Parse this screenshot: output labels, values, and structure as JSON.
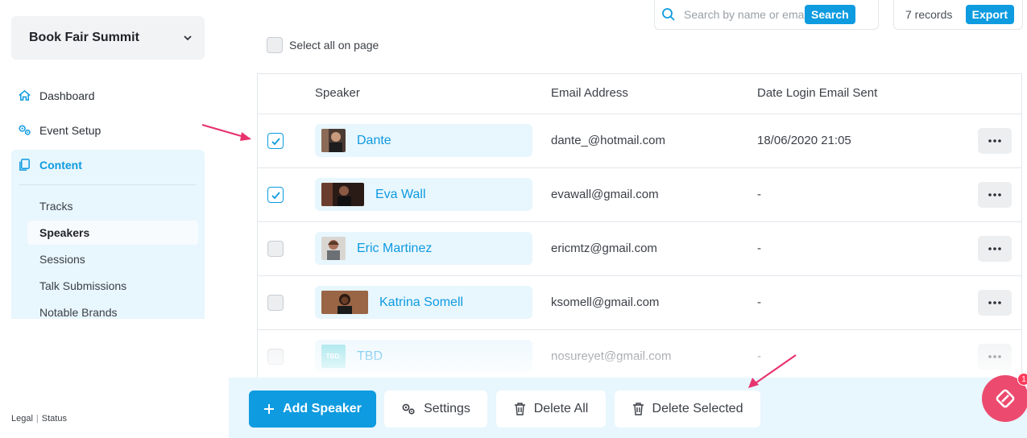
{
  "sidebar": {
    "event_name": "Book Fair Summit",
    "nav": [
      {
        "label": "Dashboard",
        "icon": "home-icon"
      },
      {
        "label": "Event Setup",
        "icon": "gears-icon"
      },
      {
        "label": "Content",
        "icon": "copy-icon"
      }
    ],
    "content_items": [
      "Tracks",
      "Speakers",
      "Sessions",
      "Talk Submissions",
      "Notable Brands"
    ],
    "active_item": "Speakers",
    "footer": {
      "legal": "Legal",
      "status": "Status"
    }
  },
  "toolbar": {
    "search_placeholder": "Search by name or email",
    "search_button": "Search",
    "records": "7 records",
    "export_button": "Export"
  },
  "select_all_label": "Select all on page",
  "table": {
    "columns": [
      "Speaker",
      "Email Address",
      "Date Login Email Sent"
    ],
    "rows": [
      {
        "name": "Dante",
        "email": "dante_@hotmail.com",
        "date": "18/06/2020 21:05",
        "checked": true
      },
      {
        "name": "Eva Wall",
        "email": "evawall@gmail.com",
        "date": "-",
        "checked": true
      },
      {
        "name": "Eric Martinez",
        "email": "ericmtz@gmail.com",
        "date": "-",
        "checked": false
      },
      {
        "name": "Katrina Somell",
        "email": "ksomell@gmail.com",
        "date": "-",
        "checked": false
      },
      {
        "name": "TBD",
        "email": "nosureyet@gmail.com",
        "date": "-",
        "checked": false
      }
    ],
    "tbd_avatar_text": "TBD."
  },
  "actions": {
    "add_speaker": "Add Speaker",
    "settings": "Settings",
    "delete_all": "Delete All",
    "delete_selected": "Delete Selected"
  },
  "fab_badge": "1",
  "colors": {
    "accent": "#0e9be0",
    "panel": "#e8f6fd",
    "arrow": "#e8336f",
    "fab": "#ec4a6e"
  }
}
